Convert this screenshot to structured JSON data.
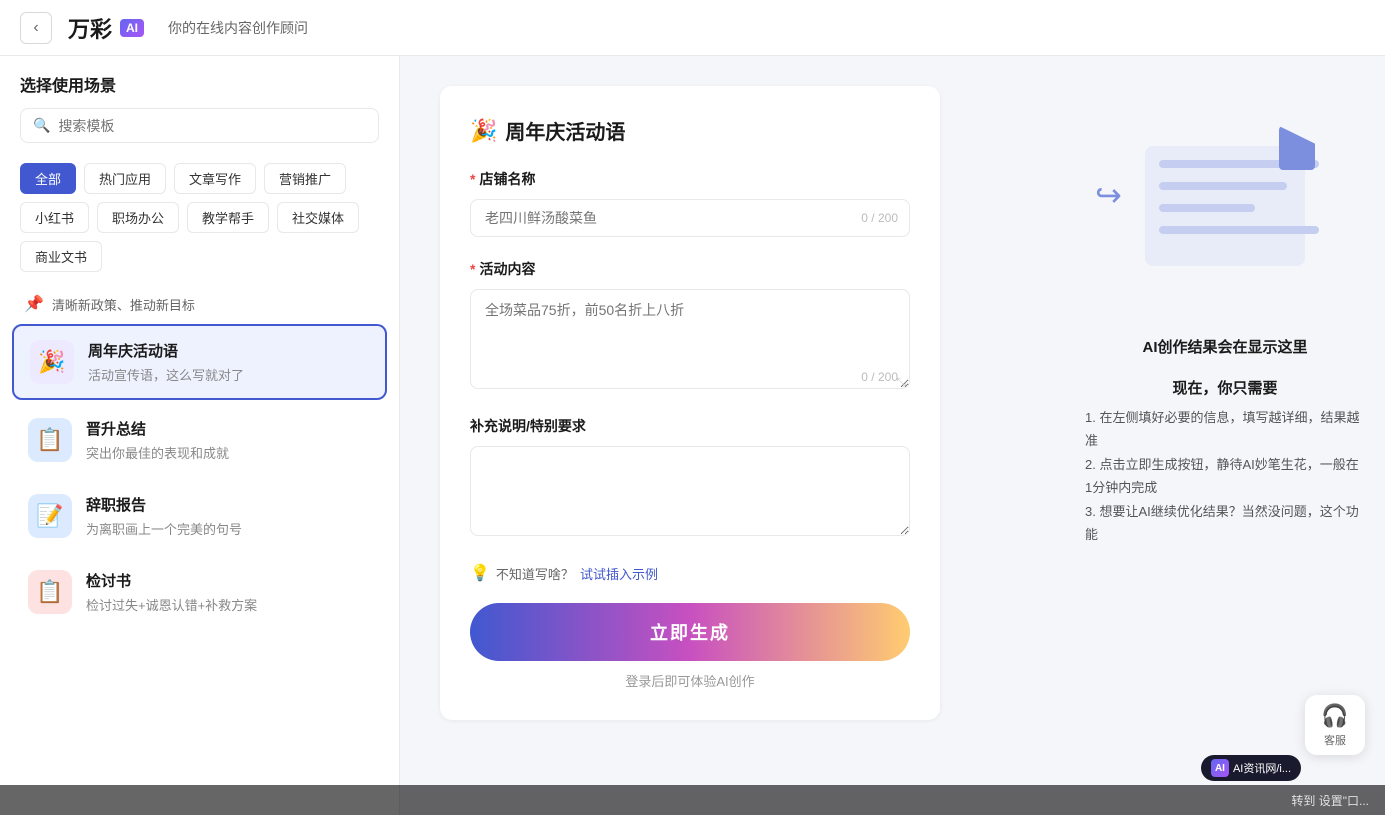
{
  "header": {
    "back_label": "‹",
    "logo_main": "万彩",
    "logo_ai": "AI",
    "subtitle": "你的在线内容创作顾问"
  },
  "sidebar": {
    "title": "选择使用场景",
    "search_placeholder": "搜索模板",
    "tags": [
      {
        "label": "全部",
        "active": true
      },
      {
        "label": "热门应用",
        "active": false
      },
      {
        "label": "文章写作",
        "active": false
      },
      {
        "label": "营销推广",
        "active": false
      },
      {
        "label": "小红书",
        "active": false
      },
      {
        "label": "职场办公",
        "active": false
      },
      {
        "label": "教学帮手",
        "active": false
      },
      {
        "label": "社交媒体",
        "active": false
      },
      {
        "label": "商业文书",
        "active": false
      }
    ],
    "promo_text": "清晰新政策、推动新目标",
    "templates": [
      {
        "id": "anniversary",
        "icon": "🎉",
        "icon_class": "purple",
        "name": "周年庆活动语",
        "desc": "活动宣传语，这么写就对了",
        "active": true
      },
      {
        "id": "promotion",
        "icon": "📋",
        "icon_class": "blue",
        "name": "晋升总结",
        "desc": "突出你最佳的表现和成就",
        "active": false
      },
      {
        "id": "resignation",
        "icon": "📝",
        "icon_class": "blue",
        "name": "辞职报告",
        "desc": "为离职画上一个完美的句号",
        "active": false
      },
      {
        "id": "review",
        "icon": "📋",
        "icon_class": "red",
        "name": "检讨书",
        "desc": "检讨过失+诚恩认错+补救方案",
        "active": false
      }
    ]
  },
  "form": {
    "title": "周年庆活动语",
    "title_icon": "🎉",
    "fields": {
      "store_name": {
        "label": "店铺名称",
        "required": true,
        "placeholder": "老四川鲜汤酸菜鱼",
        "char_count": "0 / 200"
      },
      "activity_content": {
        "label": "活动内容",
        "required": true,
        "placeholder": "全场菜品75折，前50名折上八折",
        "char_count": "0 / 200"
      },
      "supplement": {
        "label": "补充说明/特别要求",
        "required": false,
        "placeholder": "",
        "char_count": ""
      }
    },
    "hint": {
      "icon": "💡",
      "text": "不知道写啥？试试插入示例"
    },
    "generate_btn": "立即生成",
    "login_hint": "登录后即可体验AI创作"
  },
  "illustration": {
    "title": "AI创作结果会在显示这里",
    "subtitle": "现在，你只需要",
    "steps": [
      "1. 在左侧填好必要的信息，填写越详细，结果越准",
      "2. 点击立即生成按钮，静待AI妙笔生花，一般在1分钟内完成",
      "3. 想要让AI继续优化结果？当然没问题，这个功能"
    ],
    "arrow_label": "←"
  },
  "customer_service": {
    "icon": "🎧",
    "label": "客服"
  },
  "bottom_bar": {
    "watermark": "AI资讯网/i... 转到 设置\"口..."
  }
}
